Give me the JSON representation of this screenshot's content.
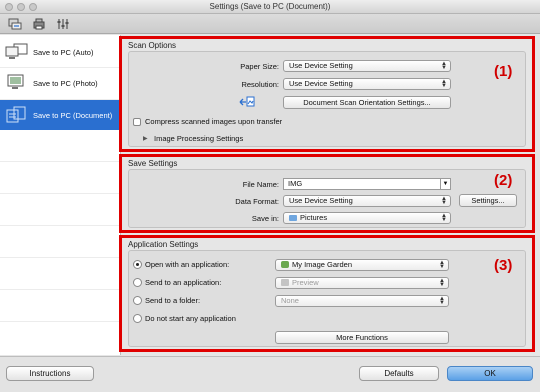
{
  "window": {
    "title": "Settings (Save to PC (Document))"
  },
  "sidebar": {
    "items": [
      {
        "label": "Save to PC (Auto)"
      },
      {
        "label": "Save to PC (Photo)"
      },
      {
        "label": "Save to PC (Document)"
      }
    ],
    "selected_index": 2
  },
  "scan_options": {
    "title": "Scan Options",
    "number": "(1)",
    "paper_size_label": "Paper Size:",
    "paper_size_value": "Use Device Setting",
    "resolution_label": "Resolution:",
    "resolution_value": "Use Device Setting",
    "orientation_button": "Document Scan Orientation Settings...",
    "compress_label": "Compress scanned images upon transfer",
    "compress_checked": false,
    "image_processing_label": "Image Processing Settings"
  },
  "save_settings": {
    "title": "Save Settings",
    "number": "(2)",
    "file_name_label": "File Name:",
    "file_name_value": "IMG",
    "data_format_label": "Data Format:",
    "data_format_value": "Use Device Setting",
    "settings_button": "Settings...",
    "save_in_label": "Save in:",
    "save_in_value": "Pictures"
  },
  "application_settings": {
    "title": "Application Settings",
    "number": "(3)",
    "open_with_label": "Open with an application:",
    "open_with_value": "My Image Garden",
    "send_app_label": "Send to an application:",
    "send_app_value": "Preview",
    "send_folder_label": "Send to a folder:",
    "send_folder_value": "None",
    "no_app_label": "Do not start any application",
    "more_functions_button": "More Functions",
    "selected_option": "open_with"
  },
  "footer": {
    "instructions_button": "Instructions",
    "defaults_button": "Defaults",
    "ok_button": "OK"
  }
}
